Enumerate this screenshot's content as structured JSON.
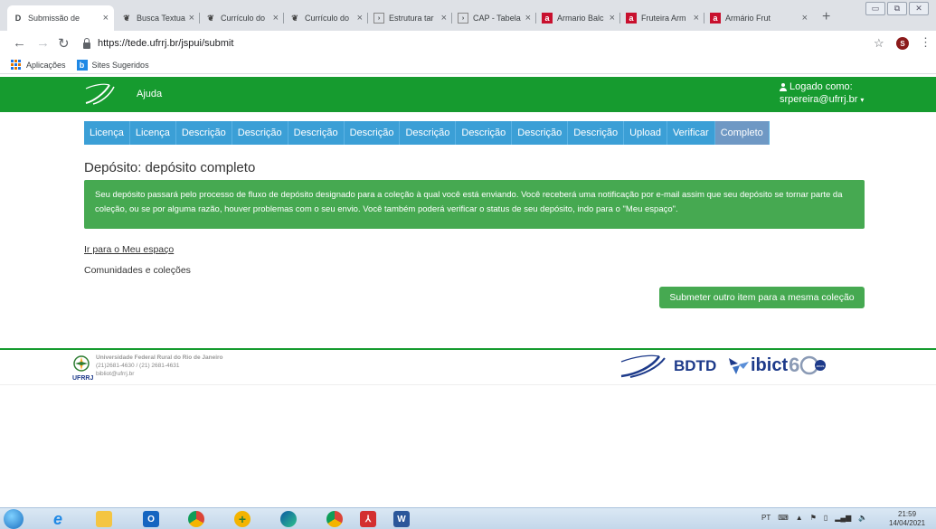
{
  "browser": {
    "tabs": [
      {
        "title": "Submissão de",
        "favicon": "D",
        "active": true
      },
      {
        "title": "Busca Textual",
        "favicon": "cnpq"
      },
      {
        "title": "Currículo do",
        "favicon": "cnpq"
      },
      {
        "title": "Currículo do",
        "favicon": "cnpq"
      },
      {
        "title": "Estrutura tar",
        "favicon": "doc"
      },
      {
        "title": "CAP - Tabela",
        "favicon": "doc"
      },
      {
        "title": "Armario Balc",
        "favicon": "store"
      },
      {
        "title": "Fruteira Arm",
        "favicon": "store"
      },
      {
        "title": "Armário Frut",
        "favicon": "store"
      }
    ],
    "new_tab_symbol": "+",
    "url": "https://tede.ufrrj.br/jspui/submit",
    "profile_initial": "S",
    "bookmarks": [
      {
        "label": "Aplicações",
        "icon": "apps-grid-icon"
      },
      {
        "label": "Sites Sugeridos",
        "icon": "bing-icon"
      }
    ]
  },
  "site": {
    "help": "Ajuda",
    "logged_label": "Logado como:",
    "user_email": "srpereira@ufrrj.br",
    "steps": [
      "Licença",
      "Licença",
      "Descrição",
      "Descrição",
      "Descrição",
      "Descrição",
      "Descrição",
      "Descrição",
      "Descrição",
      "Descrição",
      "Upload",
      "Verificar",
      "Completo"
    ],
    "active_step": 12,
    "title": "Depósito: depósito completo",
    "alert": "Seu depósito passará pelo processo de fluxo de depósito designado para a coleção à qual você está enviando. Você receberá uma notificação por e-mail assim que seu depósito se tornar parte da coleção, ou se por alguma razão, houver problemas com o seu envio. Você também poderá verificar o status de seu depósito, indo para o \"Meu espaço\".",
    "link_my_space": "Ir para o Meu espaço",
    "link_communities": "Comunidades e coleções",
    "submit_button": "Submeter outro item para a mesma coleção"
  },
  "footer": {
    "university": "Universidade Federal Rural do Rio de Janeiro",
    "phone": "(21)2681-4630 / (21) 2681-4631",
    "email": "bibliot@ufrrj.br",
    "abbr": "UFRRJ",
    "bdtd": "BDTD",
    "ibict": "ibict",
    "ibict_sixty": "6",
    "anos": "anos"
  },
  "taskbar": {
    "lang": "PT",
    "time": "21:59",
    "date": "14/04/2021"
  },
  "colors": {
    "green_header": "#169b2f",
    "step_blue": "#3b9fd6",
    "alert_green": "#46a951"
  }
}
